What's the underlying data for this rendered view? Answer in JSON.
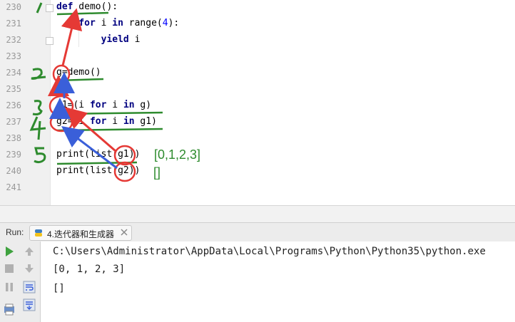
{
  "editor": {
    "lines": [
      {
        "no": "230",
        "tokens": [
          {
            "t": "def",
            "kw": true
          },
          {
            "t": " demo():"
          }
        ]
      },
      {
        "no": "231",
        "tokens": [
          {
            "t": "    "
          },
          {
            "t": "for",
            "kw": true
          },
          {
            "t": " i "
          },
          {
            "t": "in",
            "kw": true
          },
          {
            "t": " range("
          },
          {
            "t": "4",
            "num": true
          },
          {
            "t": "):"
          }
        ]
      },
      {
        "no": "232",
        "tokens": [
          {
            "t": "        "
          },
          {
            "t": "yield",
            "kw": true
          },
          {
            "t": " i"
          }
        ]
      },
      {
        "no": "233",
        "tokens": []
      },
      {
        "no": "234",
        "tokens": [
          {
            "t": "g=demo()"
          }
        ]
      },
      {
        "no": "235",
        "tokens": []
      },
      {
        "no": "236",
        "tokens": [
          {
            "t": "g1=(i "
          },
          {
            "t": "for",
            "kw": true
          },
          {
            "t": " i "
          },
          {
            "t": "in",
            "kw": true
          },
          {
            "t": " g)"
          }
        ]
      },
      {
        "no": "237",
        "tokens": [
          {
            "t": "g2=(i "
          },
          {
            "t": "for",
            "kw": true
          },
          {
            "t": " i "
          },
          {
            "t": "in",
            "kw": true
          },
          {
            "t": " g1)"
          }
        ]
      },
      {
        "no": "238",
        "tokens": []
      },
      {
        "no": "239",
        "tokens": [
          {
            "t": "print(list(g1))"
          }
        ]
      },
      {
        "no": "240",
        "tokens": [
          {
            "t": "print(list(g2))"
          }
        ]
      },
      {
        "no": "241",
        "tokens": []
      }
    ]
  },
  "annotations": {
    "result1": "[0,1,2,3]",
    "result2": "[]",
    "step_marks": [
      "1",
      "2",
      "3",
      "4",
      "5"
    ]
  },
  "run_panel": {
    "label": "Run:",
    "tab_label": "4.迭代器和生成器",
    "console_lines": [
      "C:\\Users\\Administrator\\AppData\\Local\\Programs\\Python\\Python35\\python.exe",
      "[0, 1, 2, 3]",
      "[]"
    ]
  },
  "colors": {
    "keyword": "#000080",
    "number": "#0000ff",
    "annotation_green": "#2e8b2e",
    "annotation_red": "#e53935",
    "annotation_blue": "#3a5fd9",
    "run_green": "#3fa23f"
  },
  "icons": [
    "run-icon",
    "stop-icon",
    "pause-icon",
    "up-arrow-icon",
    "down-arrow-icon",
    "soft-wrap-icon",
    "scroll-to-end-icon",
    "print-icon",
    "python-file-icon",
    "close-icon"
  ]
}
